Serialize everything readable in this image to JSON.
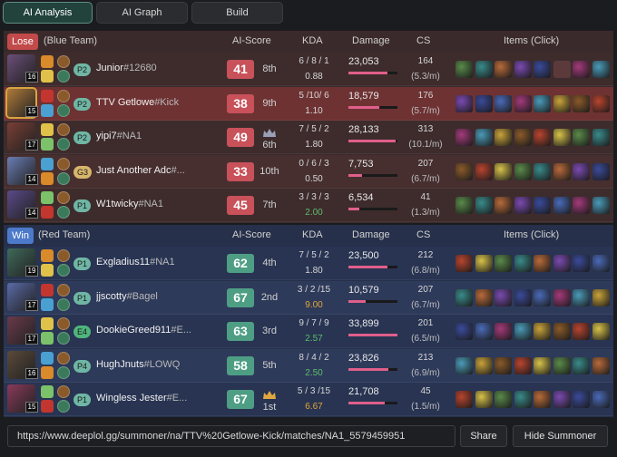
{
  "tabs": [
    "AI Analysis",
    "AI Graph",
    "Build"
  ],
  "lose": {
    "badge": "Lose",
    "team": "(Blue Team)",
    "headers": {
      "score": "AI-Score",
      "kda": "KDA",
      "damage": "Damage",
      "cs": "CS",
      "items": "Items (Click)"
    },
    "players": [
      {
        "level": "16",
        "rank": "P2",
        "name": "Junior",
        "tag": "#12680",
        "score": "41",
        "place": "8th",
        "kda": "6 / 8 / 1",
        "ratio": "0.88",
        "damage": "23,053",
        "dmg_frac": 0.79,
        "cs": "164",
        "csm": "(5.3/m)",
        "ratio_color": "normal",
        "crown": false
      },
      {
        "level": "15",
        "rank": "P2",
        "name": "TTV Getlowe",
        "tag": "#Kick",
        "score": "38",
        "place": "9th",
        "kda": "5 /10/ 6",
        "ratio": "1.10",
        "damage": "18,579",
        "dmg_frac": 0.63,
        "cs": "176",
        "csm": "(5.7/m)",
        "ratio_color": "normal",
        "crown": false
      },
      {
        "level": "17",
        "rank": "P2",
        "name": "yipi7",
        "tag": "#NA1",
        "score": "49",
        "place": "6th",
        "kda": "7 / 5 / 2",
        "ratio": "1.80",
        "damage": "28,133",
        "dmg_frac": 0.96,
        "cs": "313",
        "csm": "(10.1/m)",
        "ratio_color": "normal",
        "crown": true
      },
      {
        "level": "14",
        "rank": "G3",
        "name": "Just Another Adc",
        "tag": "#...",
        "score": "33",
        "place": "10th",
        "kda": "0 / 6 / 3",
        "ratio": "0.50",
        "damage": "7,753",
        "dmg_frac": 0.27,
        "cs": "207",
        "csm": "(6.7/m)",
        "ratio_color": "normal",
        "crown": false
      },
      {
        "level": "14",
        "rank": "P1",
        "name": "W1twicky",
        "tag": "#NA1",
        "score": "45",
        "place": "7th",
        "kda": "3 / 3 / 3",
        "ratio": "2.00",
        "damage": "6,534",
        "dmg_frac": 0.22,
        "cs": "41",
        "csm": "(1.3/m)",
        "ratio_color": "green",
        "crown": false
      }
    ]
  },
  "win": {
    "badge": "Win",
    "team": "(Red Team)",
    "headers": {
      "score": "AI-Score",
      "kda": "KDA",
      "damage": "Damage",
      "cs": "CS",
      "items": "Items (Click)"
    },
    "players": [
      {
        "level": "19",
        "rank": "P1",
        "name": "Exgladius11",
        "tag": "#NA1",
        "score": "62",
        "place": "4th",
        "kda": "7 / 5 / 2",
        "ratio": "1.80",
        "damage": "23,500",
        "dmg_frac": 0.8,
        "cs": "212",
        "csm": "(6.8/m)",
        "ratio_color": "normal",
        "crown": false
      },
      {
        "level": "17",
        "rank": "P1",
        "name": "jjscotty",
        "tag": "#Bagel",
        "score": "67",
        "place": "2nd",
        "kda": "3 / 2 /15",
        "ratio": "9.00",
        "damage": "10,579",
        "dmg_frac": 0.36,
        "cs": "207",
        "csm": "(6.7/m)",
        "ratio_color": "orange",
        "crown": false
      },
      {
        "level": "17",
        "rank": "E4",
        "name": "DookieGreed911",
        "tag": "#E...",
        "score": "63",
        "place": "3rd",
        "kda": "9 / 7 / 9",
        "ratio": "2.57",
        "damage": "33,899",
        "dmg_frac": 1.0,
        "cs": "201",
        "csm": "(6.5/m)",
        "ratio_color": "green",
        "crown": false
      },
      {
        "level": "16",
        "rank": "P4",
        "name": "HughJnuts",
        "tag": "#LOWQ",
        "score": "58",
        "place": "5th",
        "kda": "8 / 4 / 2",
        "ratio": "2.50",
        "damage": "23,826",
        "dmg_frac": 0.81,
        "cs": "213",
        "csm": "(6.9/m)",
        "ratio_color": "green",
        "crown": false
      },
      {
        "level": "15",
        "rank": "P1",
        "name": "Wingless Jester",
        "tag": "#E...",
        "score": "67",
        "place": "1st",
        "kda": "5 / 3 /15",
        "ratio": "6.67",
        "damage": "21,708",
        "dmg_frac": 0.74,
        "cs": "45",
        "csm": "(1.5/m)",
        "ratio_color": "orange",
        "crown": true
      }
    ]
  },
  "colors": {
    "lose_panel": "#3b2a2b",
    "win_panel": "#26304a",
    "score_red": "#c8515a",
    "score_green": "#4e9e84",
    "damage_bar": "#e05f8a",
    "crown": "#e0a840"
  },
  "url": "https://www.deeplol.gg/summoner/na/TTV%20Getlowe-Kick/matches/NA1_5579459951",
  "share_label": "Share",
  "hide_label": "Hide Summoner"
}
